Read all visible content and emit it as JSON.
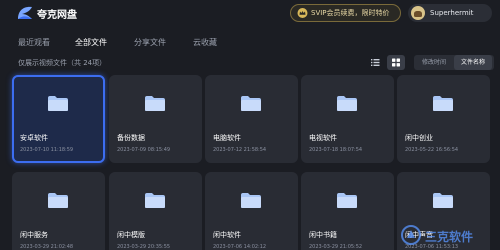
{
  "app": {
    "title": "夸克网盘"
  },
  "header": {
    "svip_text": "SVIP会员续费，限时特价",
    "user_name": "Superhermit"
  },
  "tabs": [
    {
      "label": "最近观看",
      "active": false
    },
    {
      "label": "全部文件",
      "active": true
    },
    {
      "label": "分享文件",
      "active": false
    },
    {
      "label": "云收藏",
      "active": false
    }
  ],
  "filter_note": "仅展示视频文件（共 24项）",
  "view_toggle": {
    "list_icon": "list-icon",
    "grid_icon": "grid-icon",
    "active": "grid"
  },
  "sort": {
    "options": [
      "修改时间",
      "文件名称"
    ],
    "active": "文件名称"
  },
  "folders": [
    {
      "name": "安卓软件",
      "date": "2023-07-10 11:18:59",
      "selected": true
    },
    {
      "name": "备份数据",
      "date": "2023-07-09 08:15:49",
      "selected": false
    },
    {
      "name": "电脑软件",
      "date": "2023-07-12 21:58:54",
      "selected": false
    },
    {
      "name": "电视软件",
      "date": "2023-07-18 18:07:54",
      "selected": false
    },
    {
      "name": "闲中创业",
      "date": "2023-05-22 16:56:54",
      "selected": false
    },
    {
      "name": "闲中服务",
      "date": "2023-03-29 21:02:48",
      "selected": false
    },
    {
      "name": "闲中模版",
      "date": "2023-03-29 20:35:55",
      "selected": false
    },
    {
      "name": "闲中软件",
      "date": "2023-07-06 14:02:12",
      "selected": false
    },
    {
      "name": "闲中书籍",
      "date": "2023-03-29 21:05:52",
      "selected": false
    },
    {
      "name": "闲中声音",
      "date": "2023-07-06 11:53:13",
      "selected": false
    }
  ],
  "watermark": {
    "text": "三克软件"
  },
  "colors": {
    "background": "#1b1d23",
    "card": "#292c34",
    "accent": "#3c6df0",
    "folder": "#a9c6f5",
    "svip_gold": "#e9d9a6"
  }
}
